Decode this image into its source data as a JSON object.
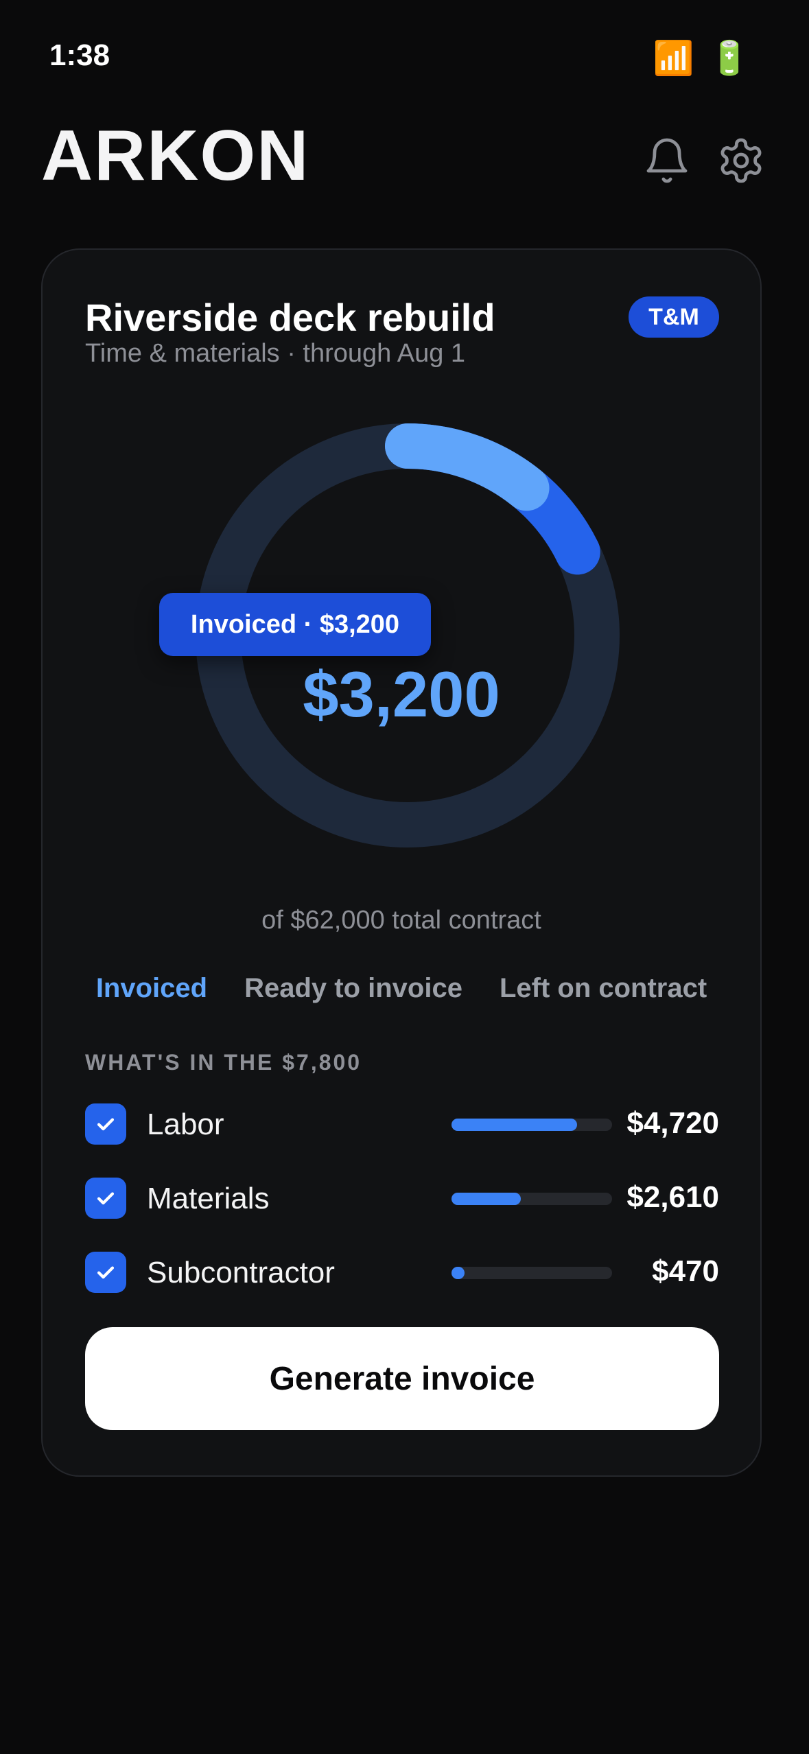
{
  "status_bar": {
    "time": "1:38",
    "signal_icon": "📶",
    "battery_icon": "🔋"
  },
  "header": {
    "brand": "ARKON",
    "icons": [
      "bell-icon",
      "gear-icon"
    ]
  },
  "project": {
    "title": "Riverside deck rebuild",
    "subtitle": "Time & materials · through Aug 1",
    "badge": "T&M"
  },
  "summary": {
    "tooltip": "Invoiced · $3,200",
    "amount": "$3,200",
    "total_text": "of $62,000 total contract",
    "invoiced_fraction": 0.0516,
    "ready_fraction": 0.1258
  },
  "tabs": [
    {
      "label": "Invoiced",
      "active": true
    },
    {
      "label": "Ready to invoice",
      "active": false
    },
    {
      "label": "Left on contract",
      "active": false
    }
  ],
  "breakdown": {
    "section_label": "WHAT'S IN THE $7,800",
    "items": [
      {
        "label": "Labor",
        "amount": "$4,720",
        "share": 0.78,
        "checked": true
      },
      {
        "label": "Materials",
        "amount": "$2,610",
        "share": 0.43,
        "checked": true
      },
      {
        "label": "Subcontractor",
        "amount": "$470",
        "share": 0.08,
        "checked": true
      }
    ]
  },
  "cta": {
    "label": "Generate invoice"
  },
  "colors": {
    "background": "#0a0a0b",
    "card": "#111214",
    "accent": "#2563eb",
    "accent_light": "#60a5fa",
    "track": "#1e293b"
  }
}
